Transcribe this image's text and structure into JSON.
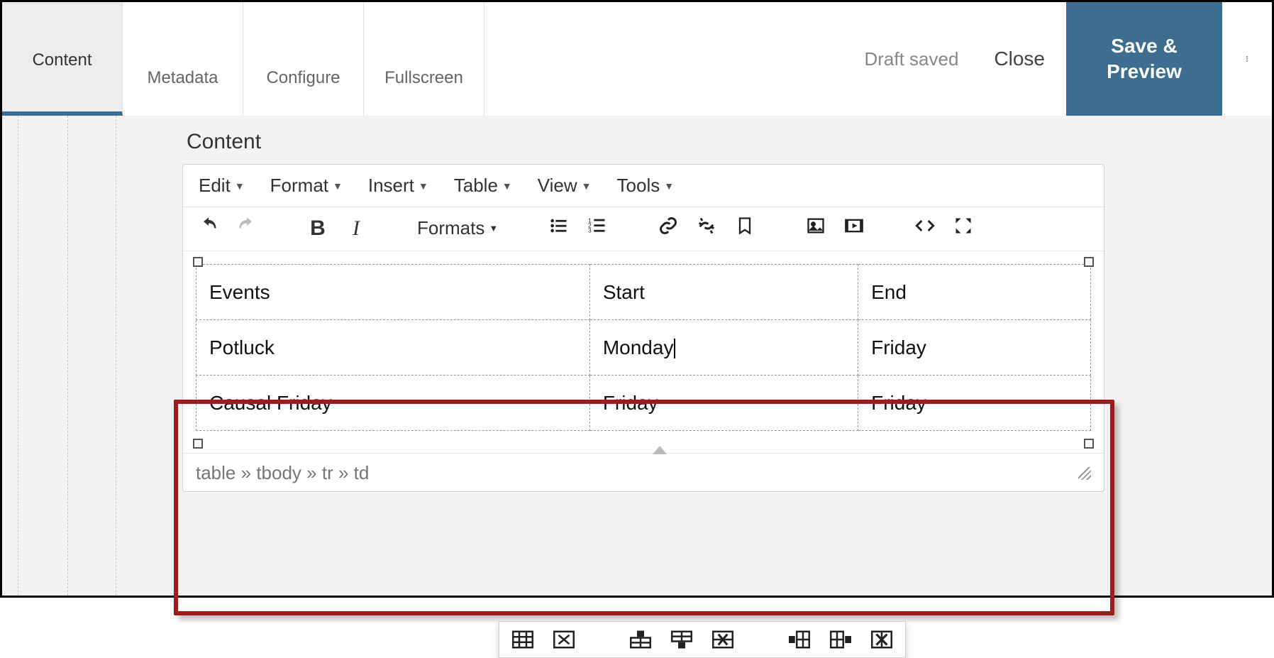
{
  "topbar": {
    "tabs": [
      {
        "label": "Content"
      },
      {
        "label": "Metadata"
      },
      {
        "label": "Configure"
      },
      {
        "label": "Fullscreen"
      }
    ],
    "status": "Draft saved",
    "close": "Close",
    "save_preview": "Save & Preview"
  },
  "section_title": "Content",
  "menubar": {
    "items": [
      "Edit",
      "Format",
      "Insert",
      "Table",
      "View",
      "Tools"
    ]
  },
  "toolbar": {
    "formats_label": "Formats"
  },
  "table_data": {
    "rows": [
      [
        "Events",
        "Start",
        "End"
      ],
      [
        "Potluck",
        "Monday",
        "Friday"
      ],
      [
        "Causal Friday",
        "Friday",
        "Friday"
      ]
    ],
    "cursor_cell": {
      "row": 1,
      "col": 1
    }
  },
  "pathbar": {
    "segments": [
      "table",
      "tbody",
      "tr",
      "td"
    ],
    "sep": " » "
  }
}
